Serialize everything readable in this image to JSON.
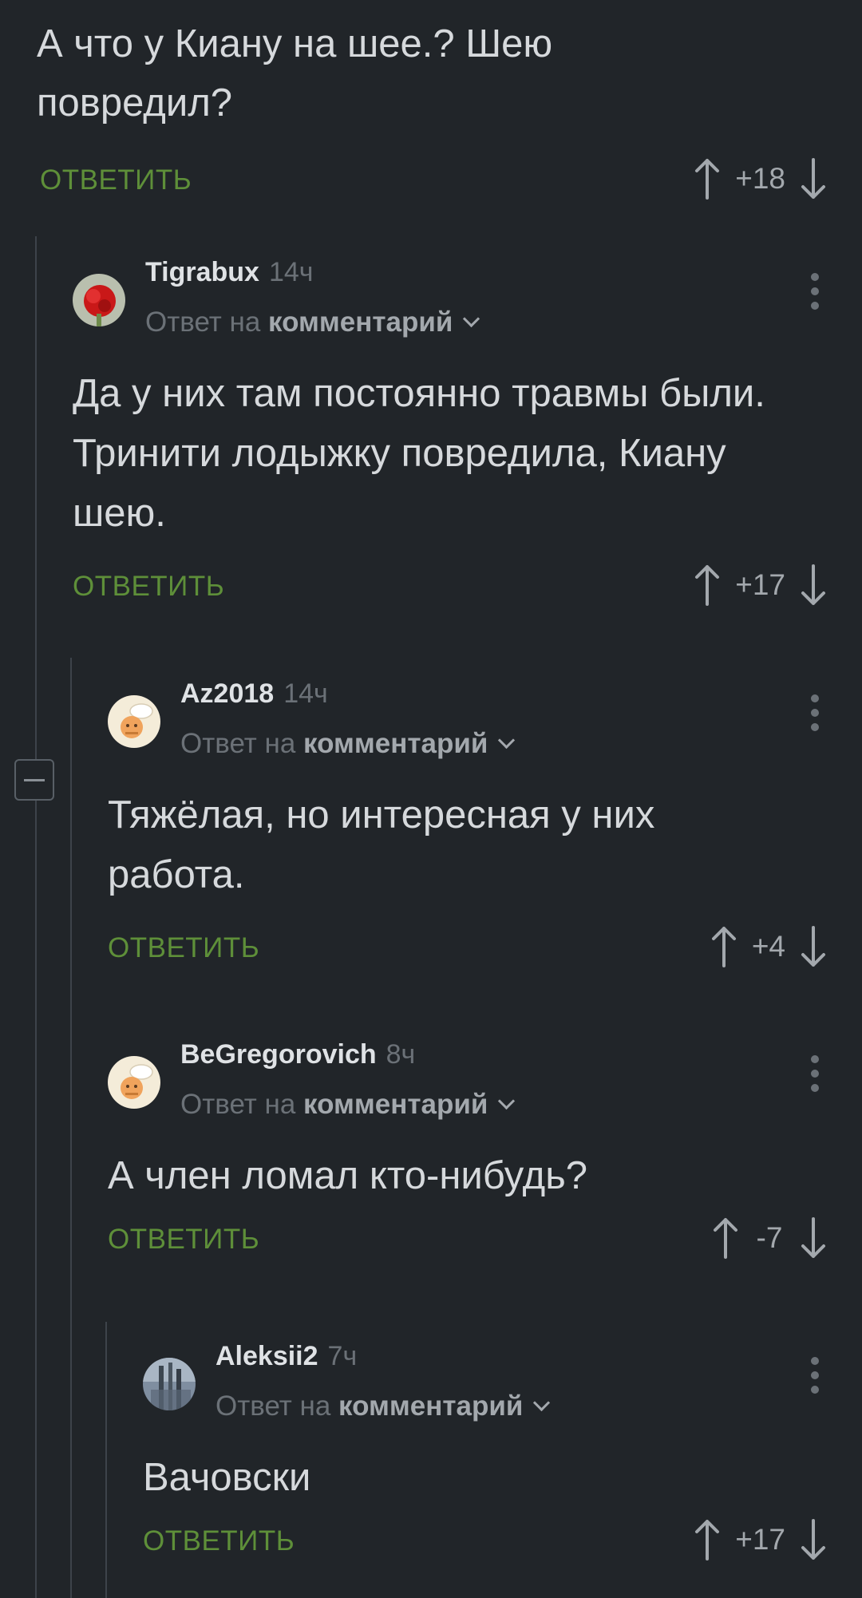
{
  "parent_comment": {
    "text": "А что у Киану на шее.? Шею повредил?",
    "reply_label": "ОТВЕТИТЬ",
    "score": "+18"
  },
  "comments": [
    {
      "author": "Tigrabux",
      "time": "14ч",
      "reply_prefix": "Ответ на",
      "reply_target": "комментарий",
      "text": "Да у них там постоянно травмы были. Тринити лодыжку повредила, Киану шею.",
      "reply_label": "ОТВЕТИТЬ",
      "score": "+17"
    },
    {
      "author": "Az2018",
      "time": "14ч",
      "reply_prefix": "Ответ на",
      "reply_target": "комментарий",
      "text": "Тяжёлая, но интересная у них работа.",
      "reply_label": "ОТВЕТИТЬ",
      "score": "+4"
    },
    {
      "author": "BeGregorovich",
      "time": "8ч",
      "reply_prefix": "Ответ на",
      "reply_target": "комментарий",
      "text": "А член ломал кто-нибудь?",
      "reply_label": "ОТВЕТИТЬ",
      "score": "-7"
    },
    {
      "author": "Aleksii2",
      "time": "7ч",
      "reply_prefix": "Ответ на",
      "reply_target": "комментарий",
      "text": "Вачовски",
      "reply_label": "ОТВЕТИТЬ",
      "score": "+17"
    }
  ],
  "colors": {
    "background": "#212529",
    "reply_green": "#5e8f39",
    "text": "#d6d9dc",
    "muted": "#6b7177"
  },
  "icons": {
    "upvote": "arrow-up-icon",
    "downvote": "arrow-down-icon",
    "menu": "more-vertical-icon",
    "expand": "chevron-down-icon",
    "collapse": "minus-icon"
  }
}
